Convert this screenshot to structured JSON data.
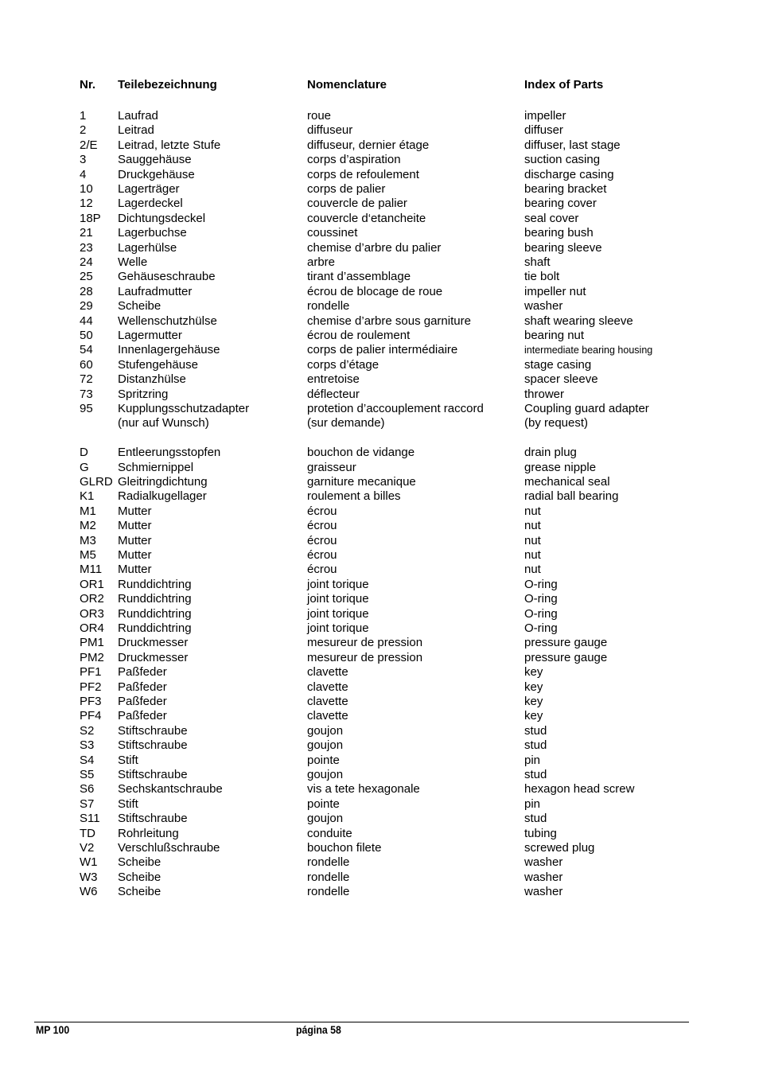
{
  "header": {
    "nr": "Nr.",
    "de": "Teilebezeichnung",
    "fr": "Nomenclature",
    "en": "Index of Parts"
  },
  "rows": [
    {
      "nr": "1",
      "de": "Laufrad",
      "fr": "roue",
      "en": "impeller"
    },
    {
      "nr": "2",
      "de": "Leitrad",
      "fr": "diffuseur",
      "en": "diffuser"
    },
    {
      "nr": "2/E",
      "de": "Leitrad, letzte Stufe",
      "fr": "diffuseur, dernier étage",
      "en": "diffuser, last stage"
    },
    {
      "nr": "3",
      "de": "Sauggehäuse",
      "fr": "corps d’aspiration",
      "en": "suction casing"
    },
    {
      "nr": "4",
      "de": "Druckgehäuse",
      "fr": "corps de refoulement",
      "en": "discharge casing"
    },
    {
      "nr": "10",
      "de": "Lagerträger",
      "fr": "corps de palier",
      "en": "bearing bracket"
    },
    {
      "nr": "12",
      "de": "Lagerdeckel",
      "fr": "couvercle de palier",
      "en": "bearing cover"
    },
    {
      "nr": "18P",
      "de": "Dichtungsdeckel",
      "fr": "couvercle d‘etancheite",
      "en": "seal cover"
    },
    {
      "nr": "21",
      "de": "Lagerbuchse",
      "fr": "coussinet",
      "en": "bearing bush"
    },
    {
      "nr": "23",
      "de": "Lagerhülse",
      "fr": "chemise d’arbre du palier",
      "en": "bearing sleeve"
    },
    {
      "nr": "24",
      "de": "Welle",
      "fr": "arbre",
      "en": "shaft"
    },
    {
      "nr": "25",
      "de": "Gehäuseschraube",
      "fr": "tirant d’assemblage",
      "en": "tie bolt"
    },
    {
      "nr": "28",
      "de": "Laufradmutter",
      "fr": "écrou de blocage de roue",
      "en": "impeller nut"
    },
    {
      "nr": "29",
      "de": "Scheibe",
      "fr": "rondelle",
      "en": "washer"
    },
    {
      "nr": "44",
      "de": "Wellenschutzhülse",
      "fr": "chemise d’arbre sous garniture",
      "en": "shaft wearing sleeve"
    },
    {
      "nr": "50",
      "de": "Lagermutter",
      "fr": "écrou de roulement",
      "en": "bearing nut"
    },
    {
      "nr": "54",
      "de": "Innenlagergehäuse",
      "fr": "corps de palier intermédiaire",
      "en": "intermediate bearing housing"
    },
    {
      "nr": "60",
      "de": "Stufengehäuse",
      "fr": "corps d’étage",
      "en": "stage casing"
    },
    {
      "nr": "72",
      "de": "Distanzhülse",
      "fr": "entretoise",
      "en": "spacer sleeve"
    },
    {
      "nr": "73",
      "de": "Spritzring",
      "fr": "déflecteur",
      "en": "thrower"
    },
    {
      "nr": "95",
      "de": "Kupplungsschutzadapter",
      "fr": "protetion d’accouplement raccord",
      "en": "Coupling guard adapter"
    },
    {
      "nr": "",
      "de": "(nur auf Wunsch)",
      "fr": "(sur demande)",
      "en": "(by request)"
    },
    {
      "nr": "D",
      "de": "Entleerungsstopfen",
      "fr": "bouchon de vidange",
      "en": "drain plug"
    },
    {
      "nr": "G",
      "de": "Schmiernippel",
      "fr": "graisseur",
      "en": "grease nipple"
    },
    {
      "nr": "GLRD",
      "de": "Gleitringdichtung",
      "fr": "garniture mecanique",
      "en": "mechanical seal"
    },
    {
      "nr": "K1",
      "de": "Radialkugellager",
      "fr": "roulement a billes",
      "en": "radial ball bearing"
    },
    {
      "nr": "M1",
      "de": "Mutter",
      "fr": "écrou",
      "en": "nut"
    },
    {
      "nr": "M2",
      "de": "Mutter",
      "fr": "écrou",
      "en": "nut"
    },
    {
      "nr": "M3",
      "de": "Mutter",
      "fr": "écrou",
      "en": "nut"
    },
    {
      "nr": "M5",
      "de": "Mutter",
      "fr": "écrou",
      "en": "nut"
    },
    {
      "nr": "M11",
      "de": "Mutter",
      "fr": "écrou",
      "en": "nut"
    },
    {
      "nr": "OR1",
      "de": "Runddichtring",
      "fr": "joint torique",
      "en": "O-ring"
    },
    {
      "nr": "OR2",
      "de": "Runddichtring",
      "fr": "joint torique",
      "en": "O-ring"
    },
    {
      "nr": "OR3",
      "de": "Runddichtring",
      "fr": "joint torique",
      "en": "O-ring"
    },
    {
      "nr": "OR4",
      "de": "Runddichtring",
      "fr": "joint torique",
      "en": "O-ring"
    },
    {
      "nr": "PM1",
      "de": "Druckmesser",
      "fr": "mesureur de pression",
      "en": "pressure gauge"
    },
    {
      "nr": "PM2",
      "de": "Druckmesser",
      "fr": "mesureur de pression",
      "en": "pressure gauge"
    },
    {
      "nr": "PF1",
      "de": "Paßfeder",
      "fr": "clavette",
      "en": "key"
    },
    {
      "nr": "PF2",
      "de": "Paßfeder",
      "fr": "clavette",
      "en": "key"
    },
    {
      "nr": "PF3",
      "de": "Paßfeder",
      "fr": "clavette",
      "en": "key"
    },
    {
      "nr": "PF4",
      "de": "Paßfeder",
      "fr": "clavette",
      "en": "key"
    },
    {
      "nr": "S2",
      "de": "Stiftschraube",
      "fr": "goujon",
      "en": "stud"
    },
    {
      "nr": "S3",
      "de": "Stiftschraube",
      "fr": "goujon",
      "en": "stud"
    },
    {
      "nr": "S4",
      "de": "Stift",
      "fr": "pointe",
      "en": "pin"
    },
    {
      "nr": "S5",
      "de": "Stiftschraube",
      "fr": "goujon",
      "en": "stud"
    },
    {
      "nr": "S6",
      "de": "Sechskantschraube",
      "fr": "vis a tete hexagonale",
      "en": "hexagon head screw"
    },
    {
      "nr": "S7",
      "de": "Stift",
      "fr": "pointe",
      "en": "pin"
    },
    {
      "nr": "S11",
      "de": "Stiftschraube",
      "fr": "goujon",
      "en": "stud"
    },
    {
      "nr": "TD",
      "de": "Rohrleitung",
      "fr": "conduite",
      "en": "tubing"
    },
    {
      "nr": "V2",
      "de": "Verschlußschraube",
      "fr": "bouchon filete",
      "en": "screwed plug"
    },
    {
      "nr": "W1",
      "de": "Scheibe",
      "fr": "rondelle",
      "en": "washer"
    },
    {
      "nr": "W3",
      "de": "Scheibe",
      "fr": "rondelle",
      "en": "washer"
    },
    {
      "nr": "W6",
      "de": "Scheibe",
      "fr": "rondelle",
      "en": "washer"
    }
  ],
  "footer": {
    "left": "MP 100",
    "center": "página 58"
  }
}
